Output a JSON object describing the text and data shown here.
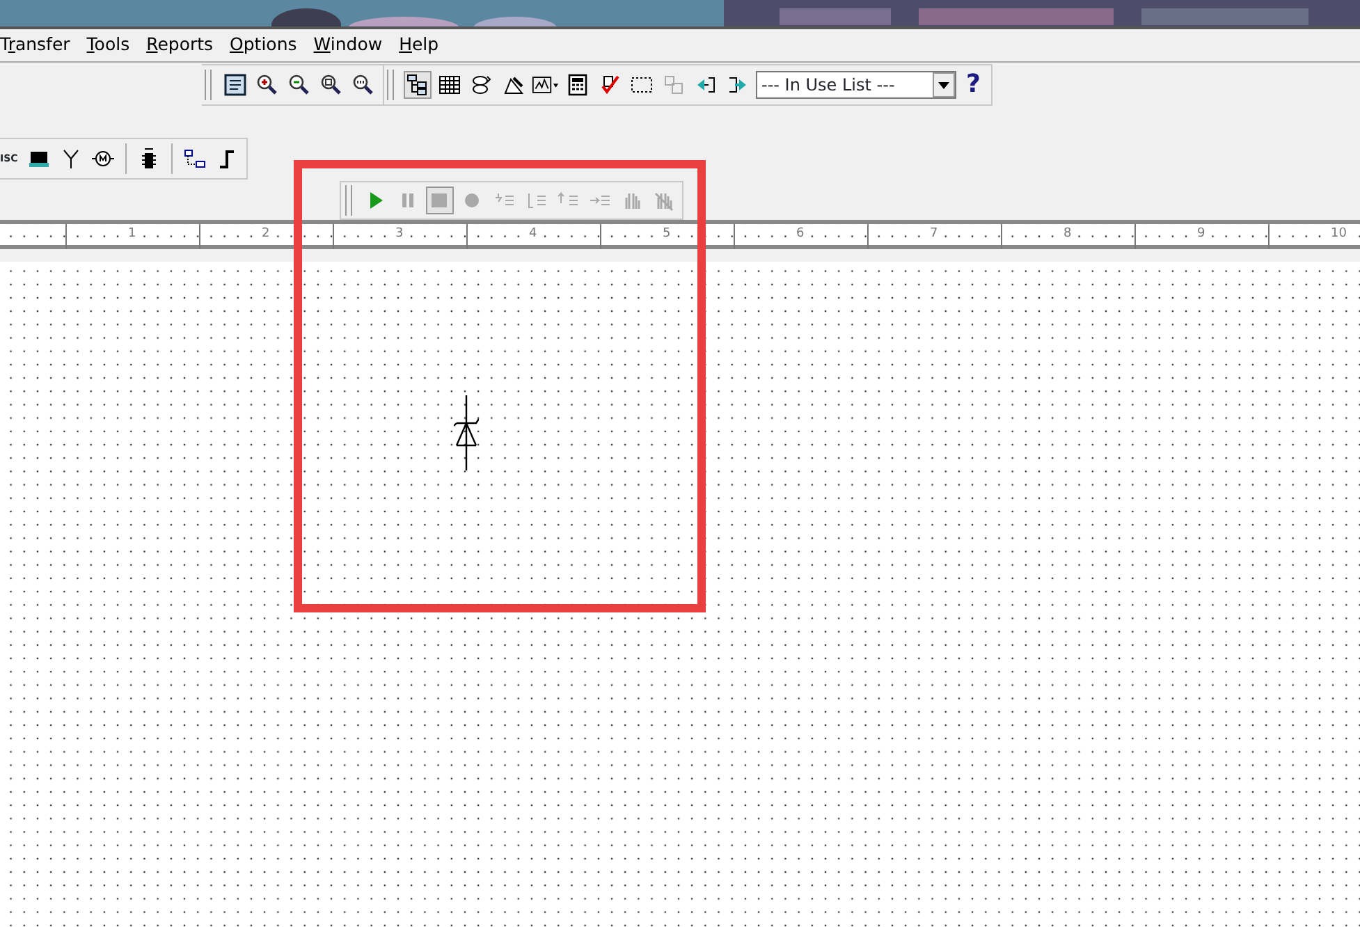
{
  "menu_bar": {
    "items": [
      {
        "label": "Transfer"
      },
      {
        "label": "Tools"
      },
      {
        "label": "Reports"
      },
      {
        "label": "Options"
      },
      {
        "label": "Window"
      },
      {
        "label": "Help"
      }
    ]
  },
  "main_toolbar": {
    "in_use_list": {
      "value": "--- In Use List ---"
    },
    "help": "?"
  },
  "place_toolbar": {
    "partial_label": "ISC"
  },
  "simulation_toolbar": {
    "buttons": [
      {
        "disabled": false,
        "pressed": false
      },
      {
        "disabled": true,
        "pressed": false
      },
      {
        "disabled": true,
        "pressed": true
      },
      {
        "disabled": true,
        "pressed": false
      },
      {
        "disabled": true,
        "pressed": false
      },
      {
        "disabled": true,
        "pressed": false
      },
      {
        "disabled": true,
        "pressed": false
      },
      {
        "disabled": true,
        "pressed": false
      },
      {
        "disabled": true,
        "pressed": false
      },
      {
        "disabled": true,
        "pressed": false
      }
    ]
  },
  "ruler": {
    "labels": [
      "1",
      "2",
      "3",
      "4",
      "5",
      "6",
      "7",
      "8",
      "9",
      "10"
    ]
  }
}
